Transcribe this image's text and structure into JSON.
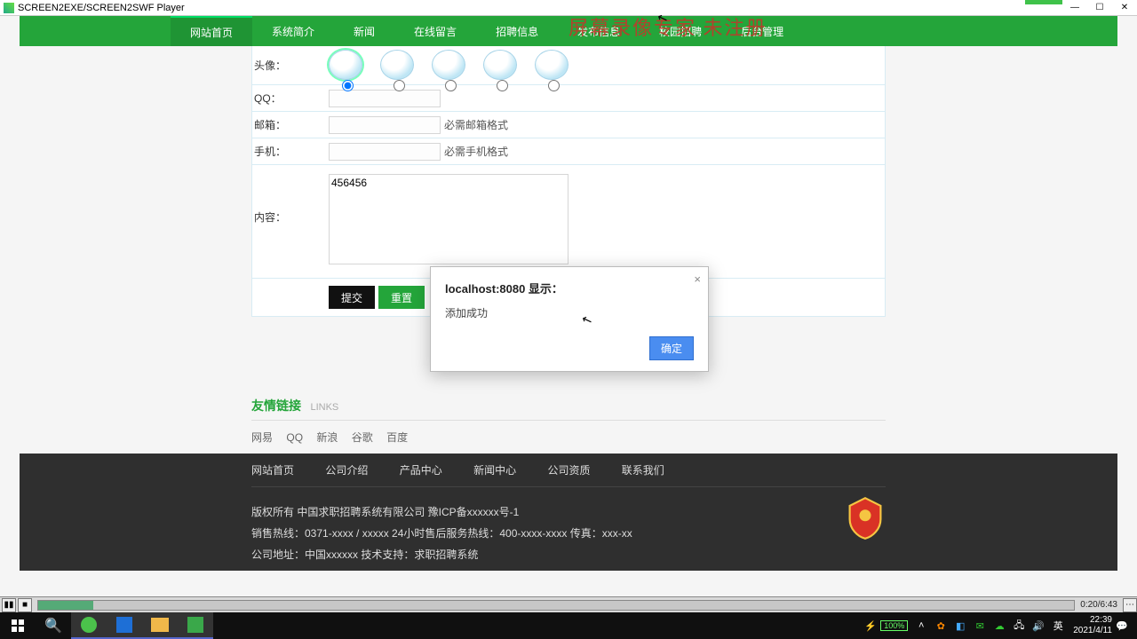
{
  "window": {
    "title": "SCREEN2EXE/SCREEN2SWF Player"
  },
  "watermark": "屏幕录像专家 未注册",
  "nav": [
    "网站首页",
    "系统简介",
    "新闻",
    "在线留言",
    "招聘信息",
    "发布信息",
    "校园招聘",
    "后台管理"
  ],
  "form": {
    "avatar_label": "头像：",
    "qq_label": "QQ：",
    "qq_value": "",
    "email_label": "邮箱：",
    "email_value": "",
    "email_hint": "必需邮箱格式",
    "phone_label": "手机：",
    "phone_value": "",
    "phone_hint": "必需手机格式",
    "content_label": "内容：",
    "content_value": "456456",
    "submit": "提交",
    "reset": "重置"
  },
  "links": {
    "zh": "友情链接",
    "en": "LINKS",
    "items": [
      "网易",
      "QQ",
      "新浪",
      "谷歌",
      "百度"
    ]
  },
  "footer": {
    "nav": [
      "网站首页",
      "公司介绍",
      "产品中心",
      "新闻中心",
      "公司资质",
      "联系我们"
    ],
    "line1": "版权所有 中国求职招聘系统有限公司 豫ICP备xxxxxx号-1",
    "line2": "销售热线：0371-xxxx / xxxxx 24小时售后服务热线：400-xxxx-xxxx 传真：xxx-xx",
    "line3": "公司地址：中国xxxxxx 技术支持：求职招聘系统"
  },
  "alert": {
    "title": "localhost:8080 显示：",
    "msg": "添加成功",
    "ok": "确定"
  },
  "player": {
    "time": "0:20/6:43"
  },
  "taskbar": {
    "battery": "100%",
    "ime": "英",
    "time": "22:39",
    "date": "2021/4/11"
  }
}
